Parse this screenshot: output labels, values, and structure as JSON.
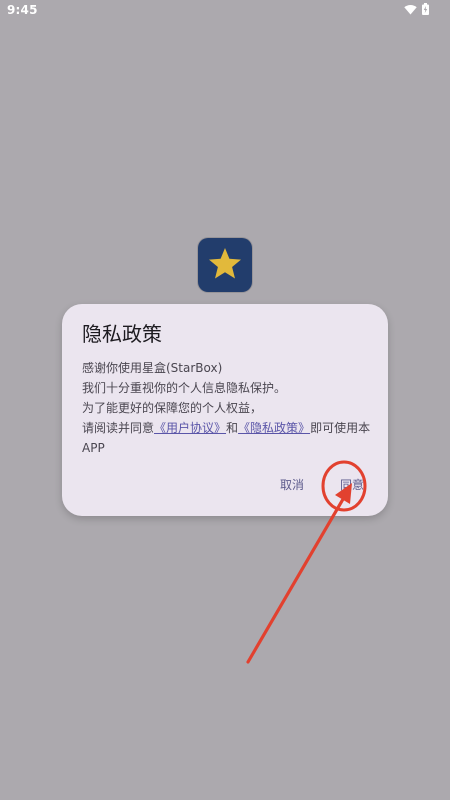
{
  "status_bar": {
    "time": "9:45",
    "wifi_icon": "wifi-icon",
    "battery_icon": "battery-charging-icon"
  },
  "app": {
    "icon": "star-icon",
    "icon_bg": "#223d6c",
    "star_color": "#e2b93b"
  },
  "dialog": {
    "title": "隐私政策",
    "lines": [
      "感谢你使用星盒(StarBox)",
      "我们十分重视你的个人信息隐私保护。",
      "为了能更好的保障您的个人权益，"
    ],
    "consent": {
      "prefix": "请阅读并同意",
      "user_agreement_link": "《用户协议》",
      "and": "和",
      "privacy_policy_link": "《隐私政策》",
      "suffix": "即可使用本",
      "wrap": "APP"
    },
    "cancel_label": "取消",
    "agree_label": "同意"
  },
  "colors": {
    "overlay": "#aca9ae",
    "dialog_bg": "#ebe5ef",
    "link": "#5a55a8",
    "annotation": "#e2412f"
  }
}
